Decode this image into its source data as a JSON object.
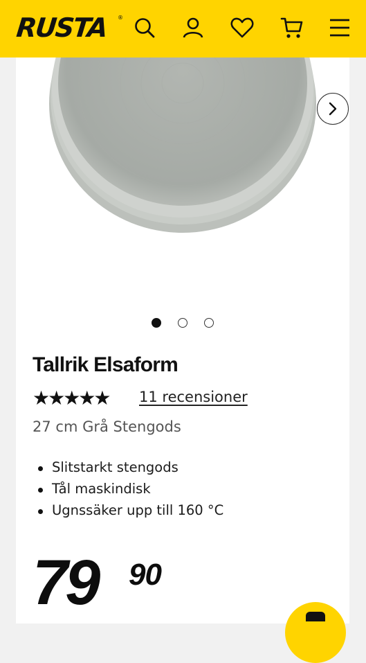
{
  "header": {
    "logo_text": "RUSTA",
    "logo_mark": "®",
    "icons": [
      "search-icon",
      "account-icon",
      "heart-icon",
      "cart-icon",
      "menu-icon"
    ],
    "brand_color": "#FFD400"
  },
  "product": {
    "gallery": {
      "image_count": 3,
      "active_index": 0,
      "next_icon": "chevron-right-icon"
    },
    "title": "Tallrik Elsaform",
    "rating": {
      "stars": "★★★★★",
      "value": 5,
      "max": 5,
      "reviews_label": "11 recensioner"
    },
    "subtitle": "27 cm Grå Stengods",
    "features": [
      "Slitstarkt stengods",
      "Tål maskindisk",
      "Ugnssäker upp till 160 °C"
    ],
    "price": {
      "integer": "79",
      "decimals": "90"
    }
  }
}
